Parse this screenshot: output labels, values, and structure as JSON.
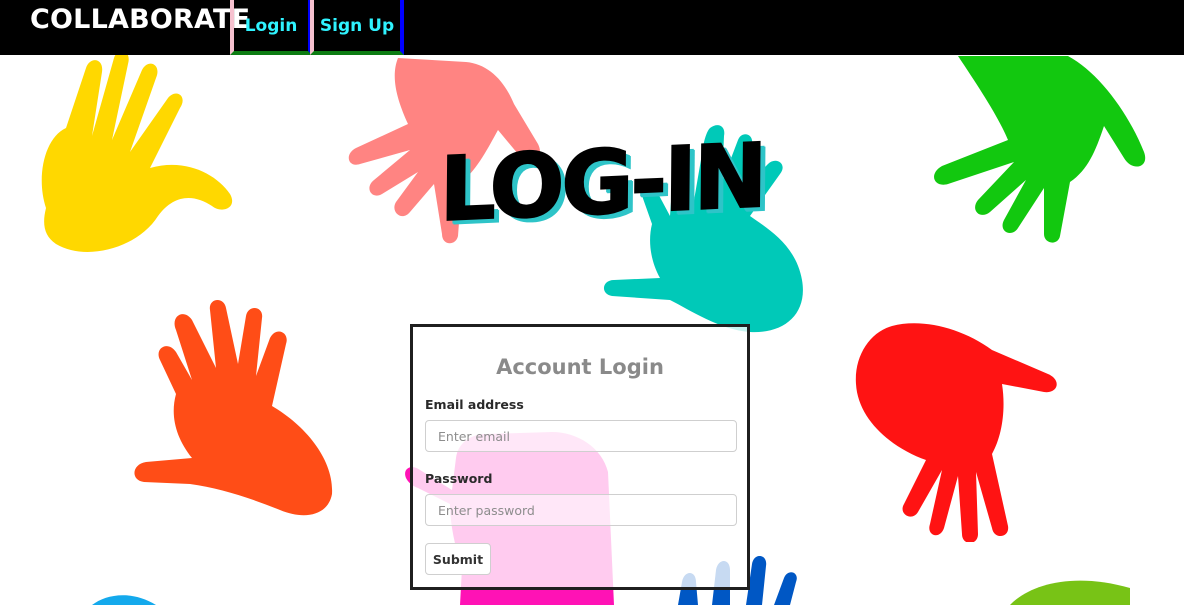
{
  "navbar": {
    "brand": "COLLABORATE",
    "links": [
      {
        "label": "Login"
      },
      {
        "label": "Sign Up"
      }
    ]
  },
  "hero": {
    "heading": "LOG-IN"
  },
  "login_card": {
    "title": "Account Login",
    "email_label": "Email address",
    "email_placeholder": "Enter email",
    "email_value": "",
    "password_label": "Password",
    "password_placeholder": "Enter password",
    "password_value": "",
    "submit_label": "Submit"
  },
  "colors": {
    "navbar_bg": "#000000",
    "nav_link_text": "#2ff3ff",
    "hand_yellow": "#ffd800",
    "hand_pink": "#ff8482",
    "hand_teal": "#00c9b8",
    "hand_green": "#12c80f",
    "hand_orange": "#ff4d17",
    "hand_red": "#ff1313",
    "hand_magenta": "#ff12b5",
    "hand_blue": "#0057c4",
    "hand_sky": "#14a9ec",
    "hand_lime": "#78c316"
  }
}
